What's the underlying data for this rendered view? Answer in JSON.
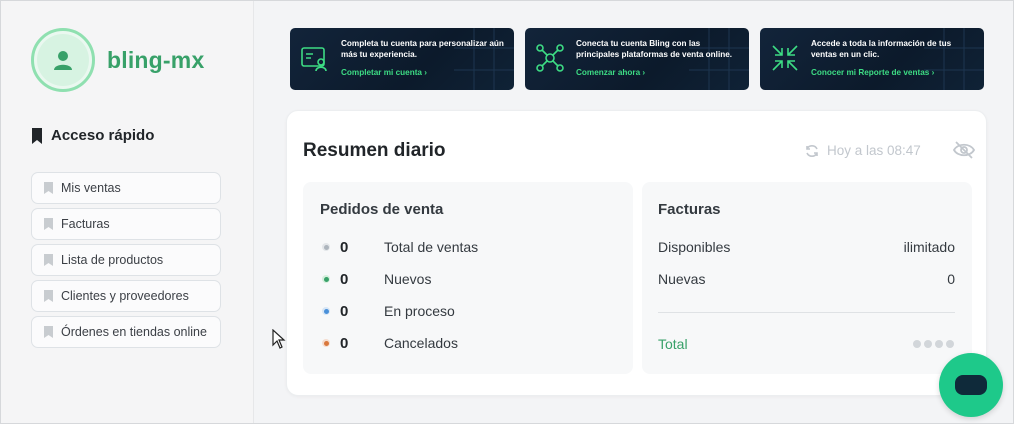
{
  "account": {
    "name": "bling-mx"
  },
  "quick_access": {
    "title": "Acceso rápido",
    "items": [
      {
        "label": "Mis ventas"
      },
      {
        "label": "Facturas"
      },
      {
        "label": "Lista de productos"
      },
      {
        "label": "Clientes y proveedores"
      },
      {
        "label": "Órdenes en tiendas online"
      }
    ]
  },
  "banners": [
    {
      "text": "Completa tu cuenta para personalizar aún más tu experiencia.",
      "link": "Completar mi cuenta",
      "icon": "profile-card-icon"
    },
    {
      "text": "Conecta tu cuenta Bling con las principales plataformas de venta online.",
      "link": "Comenzar ahora",
      "icon": "network-nodes-icon"
    },
    {
      "text": "Accede a toda la información de tus ventas en un clic.",
      "link": "Conocer mi Reporte de ventas",
      "icon": "collapse-arrows-icon"
    }
  ],
  "summary": {
    "title": "Resumen diario",
    "updated": "Hoy a las 08:47",
    "orders": {
      "title": "Pedidos de venta",
      "rows": [
        {
          "count": "0",
          "label": "Total de ventas",
          "color": "#adb5bd"
        },
        {
          "count": "0",
          "label": "Nuevos",
          "color": "#38a169"
        },
        {
          "count": "0",
          "label": "En proceso",
          "color": "#4a90d9"
        },
        {
          "count": "0",
          "label": "Cancelados",
          "color": "#d9783d"
        }
      ]
    },
    "invoices": {
      "title": "Facturas",
      "rows": [
        {
          "label": "Disponibles",
          "value": "ilimitado"
        },
        {
          "label": "Nuevas",
          "value": "0"
        }
      ],
      "total_label": "Total"
    }
  },
  "colors": {
    "brand": "#38a169",
    "banner_bg": "#12243a",
    "chat": "#1ec98a"
  }
}
